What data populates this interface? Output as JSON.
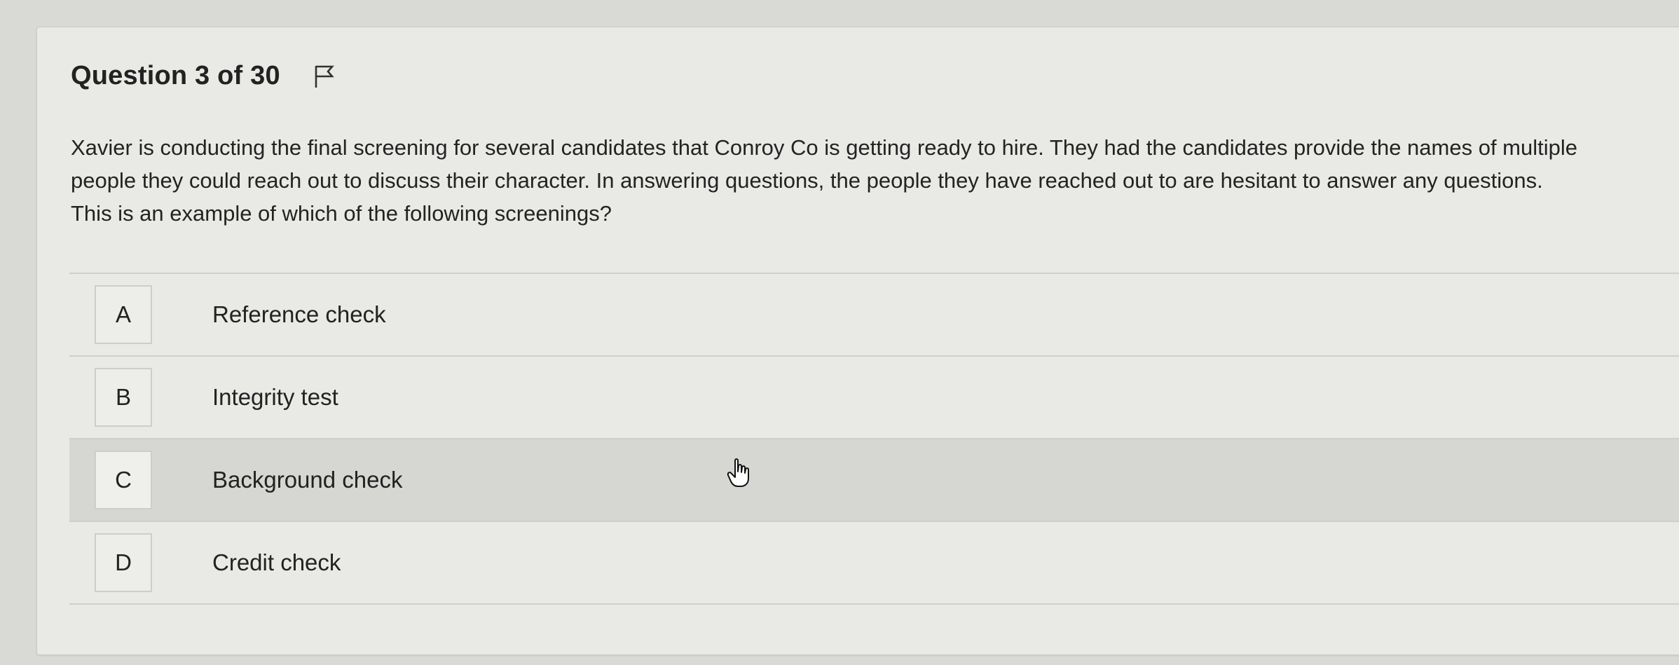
{
  "question": {
    "title": "Question 3 of 30",
    "flag_icon": "flag-icon",
    "text_lines": [
      "Xavier is conducting the final screening for several candidates that Conroy Co is getting ready to hire. They had the candidates provide the names of multiple",
      "people they could reach out to discuss their character. In answering questions, the people they have reached out to are hesitant to answer any questions.",
      "This is an example of which of the following screenings?"
    ]
  },
  "options": [
    {
      "letter": "A",
      "label": "Reference check"
    },
    {
      "letter": "B",
      "label": "Integrity test"
    },
    {
      "letter": "C",
      "label": "Background check",
      "hovered": true
    },
    {
      "letter": "D",
      "label": "Credit check"
    }
  ],
  "colors": {
    "page_bg": "#d9d9d6",
    "card_bg": "#e9e9e6",
    "hover_bg": "#d6d6d3",
    "divider": "#cfcfcc"
  }
}
